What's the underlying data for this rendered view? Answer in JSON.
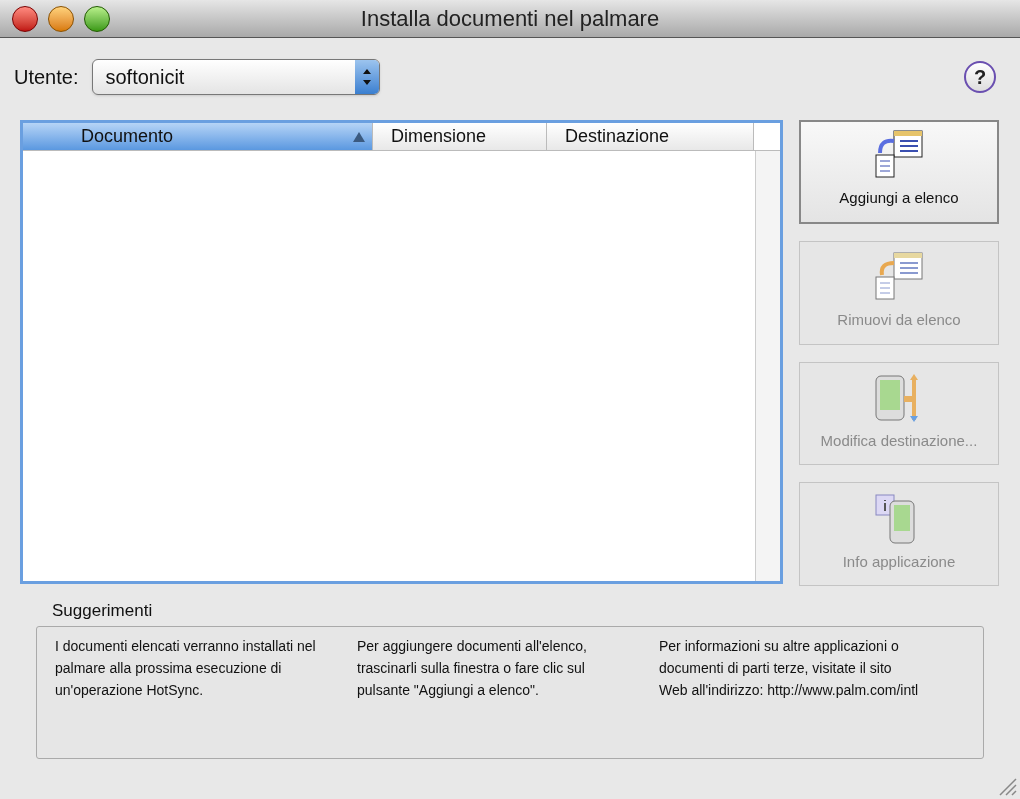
{
  "window": {
    "title": "Installa documenti nel palmare"
  },
  "user": {
    "label": "Utente:",
    "value": "softonicit"
  },
  "help": {
    "label": "?"
  },
  "table": {
    "columns": [
      {
        "label": "Documento",
        "selected": true
      },
      {
        "label": "Dimensione",
        "selected": false
      },
      {
        "label": "Destinazione",
        "selected": false
      }
    ]
  },
  "actions": [
    {
      "label": "Aggiungi a elenco",
      "kind": "add",
      "disabled": false
    },
    {
      "label": "Rimuovi da elenco",
      "kind": "remove",
      "disabled": true
    },
    {
      "label": "Modifica destinazione...",
      "kind": "destination",
      "disabled": true
    },
    {
      "label": "Info applicazione",
      "kind": "info",
      "disabled": true
    }
  ],
  "hints": {
    "title": "Suggerimenti",
    "paragraphs": [
      "I documenti elencati verranno installati nel palmare alla prossima esecuzione di un'operazione HotSync.",
      "Per aggiungere documenti all'elenco, trascinarli sulla finestra o fare clic sul pulsante \"Aggiungi a elenco\".",
      "Per informazioni su altre applicazioni o documenti di parti terze, visitate il sito Web all'indirizzo: http://www.palm.com/intl"
    ]
  }
}
